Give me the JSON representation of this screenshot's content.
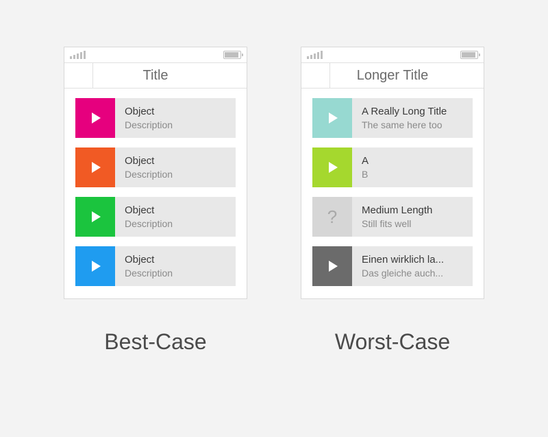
{
  "phones": [
    {
      "title": "Title",
      "caption": "Best-Case",
      "items": [
        {
          "title": "Object",
          "desc": "Description",
          "color": "#e6007e",
          "icon": "play"
        },
        {
          "title": "Object",
          "desc": "Description",
          "color": "#f15a24",
          "icon": "play"
        },
        {
          "title": "Object",
          "desc": "Description",
          "color": "#1bc43e",
          "icon": "play"
        },
        {
          "title": "Object",
          "desc": "Description",
          "color": "#1f9cf0",
          "icon": "play"
        }
      ]
    },
    {
      "title": "Longer Title",
      "caption": "Worst-Case",
      "items": [
        {
          "title": "A Really Long Title",
          "desc": "The same here too",
          "color": "#97d9d1",
          "icon": "play"
        },
        {
          "title": "A",
          "desc": "B",
          "color": "#a5d82e",
          "icon": "play"
        },
        {
          "title": "Medium Length",
          "desc": "Still fits well",
          "color": "#d6d6d6",
          "icon": "question"
        },
        {
          "title": "Einen wirklich la...",
          "desc": "Das gleiche auch...",
          "color": "#6b6b6b",
          "icon": "play"
        }
      ]
    }
  ]
}
